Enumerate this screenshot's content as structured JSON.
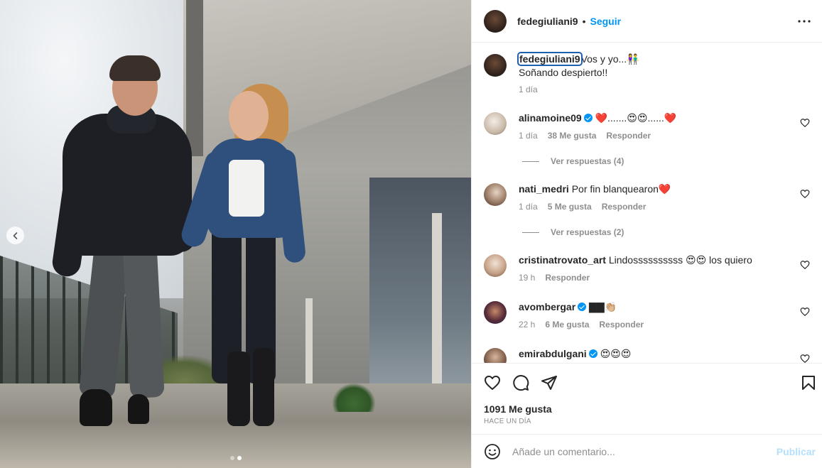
{
  "post": {
    "username": "fedegiuliani9",
    "follow_label": "Seguir",
    "separator": "•",
    "more_icon": "more-horizontal-icon",
    "caption": {
      "username": "fedegiuliani9",
      "line1": "Vos y yo...👫",
      "line2": "Soñando despierto!!",
      "time": "1 día"
    },
    "comments": [
      {
        "username": "alinamoine09",
        "verified": true,
        "text": "❤️.......😍😍......❤️",
        "time": "1 día",
        "likes": "38 Me gusta",
        "reply_label": "Responder",
        "view_replies": "Ver respuestas (4)"
      },
      {
        "username": "nati_medri",
        "verified": false,
        "text": "Por fin blanquearon❤️",
        "time": "1 día",
        "likes": "5 Me gusta",
        "reply_label": "Responder",
        "view_replies": "Ver respuestas (2)"
      },
      {
        "username": "cristinatrovato_art",
        "verified": false,
        "text": "Lindossssssssss 😍😍 los quiero",
        "time": "19 h",
        "likes": "",
        "reply_label": "Responder",
        "view_replies": ""
      },
      {
        "username": "avombergar",
        "verified": true,
        "text": "▇▇👏🏼",
        "time": "22 h",
        "likes": "6 Me gusta",
        "reply_label": "Responder",
        "view_replies": ""
      },
      {
        "username": "emirabdulgani",
        "verified": true,
        "text": "😍😍😍",
        "time": "",
        "likes": "",
        "reply_label": "",
        "view_replies": ""
      }
    ],
    "likes_count": "1091 Me gusta",
    "time_ago": "HACE UN DÍA",
    "add_comment_placeholder": "Añade un comentario...",
    "publish_label": "Publicar",
    "carousel": {
      "slides": 2,
      "active_index": 1
    },
    "colors": {
      "accent": "#0095f6",
      "publish_disabled": "#b2dffc",
      "muted": "#8e8e8e",
      "text": "#262626"
    }
  }
}
